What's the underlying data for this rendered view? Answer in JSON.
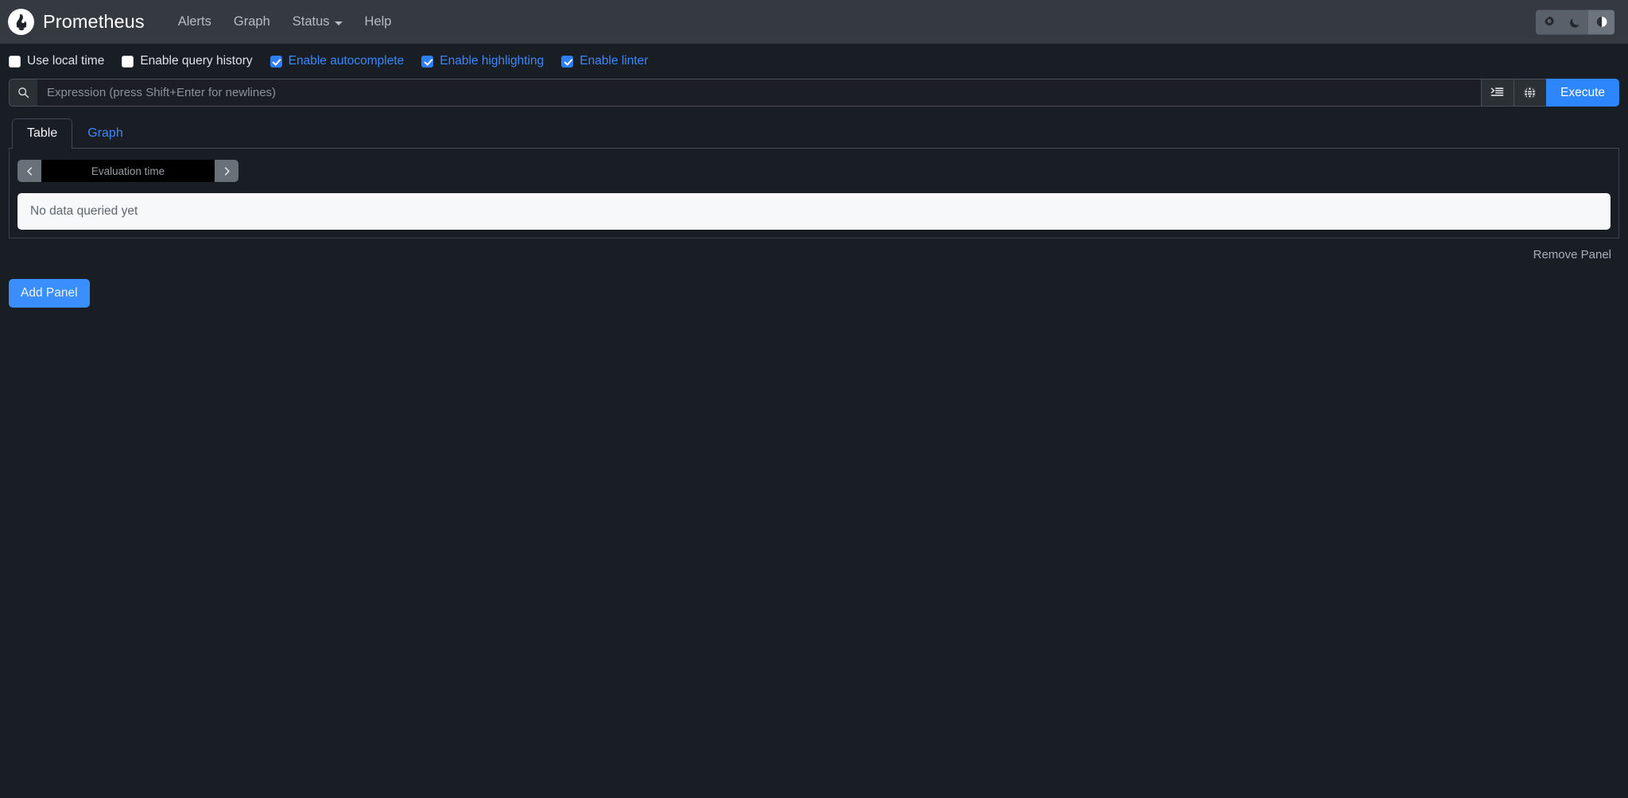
{
  "navbar": {
    "logo_icon": "prometheus-torch-logo",
    "brand": "Prometheus",
    "links": [
      {
        "label": "Alerts",
        "icon": "",
        "has_caret": false
      },
      {
        "label": "Graph",
        "icon": "",
        "has_caret": false
      },
      {
        "label": "Status",
        "icon": "",
        "has_caret": true
      },
      {
        "label": "Help",
        "icon": "",
        "has_caret": false
      }
    ],
    "theme_buttons": [
      {
        "name": "light-theme-button",
        "icon": "sun-gear-icon",
        "active": false
      },
      {
        "name": "dark-theme-button",
        "icon": "moon-icon",
        "active": false
      },
      {
        "name": "auto-theme-button",
        "icon": "half-circle-contrast-icon",
        "active": true
      }
    ]
  },
  "options": [
    {
      "label": "Use local time",
      "checked": false
    },
    {
      "label": "Enable query history",
      "checked": false
    },
    {
      "label": "Enable autocomplete",
      "checked": true
    },
    {
      "label": "Enable highlighting",
      "checked": true
    },
    {
      "label": "Enable linter",
      "checked": true
    }
  ],
  "expression": {
    "search_icon": "search-icon",
    "value": "",
    "placeholder": "Expression (press Shift+Enter for newlines)",
    "metrics_explorer_icon": "metrics-explorer-icon",
    "globe_icon": "globe-icon",
    "execute_label": "Execute"
  },
  "tabs": [
    {
      "label": "Table",
      "active": true
    },
    {
      "label": "Graph",
      "active": false
    }
  ],
  "panel": {
    "eval_prev_icon": "chevron-left-icon",
    "eval_next_icon": "chevron-right-icon",
    "eval_value": "",
    "eval_placeholder": "Evaluation time",
    "no_data_text": "No data queried yet",
    "remove_panel_label": "Remove Panel"
  },
  "footer": {
    "add_panel_label": "Add Panel"
  },
  "colors": {
    "navbar_bg": "#343a40",
    "body_bg": "#191d24",
    "accent_blue": "#2e86fd",
    "link_blue": "#3b88fd",
    "alert_bg": "#f6f8fa",
    "border": "#444a52"
  }
}
